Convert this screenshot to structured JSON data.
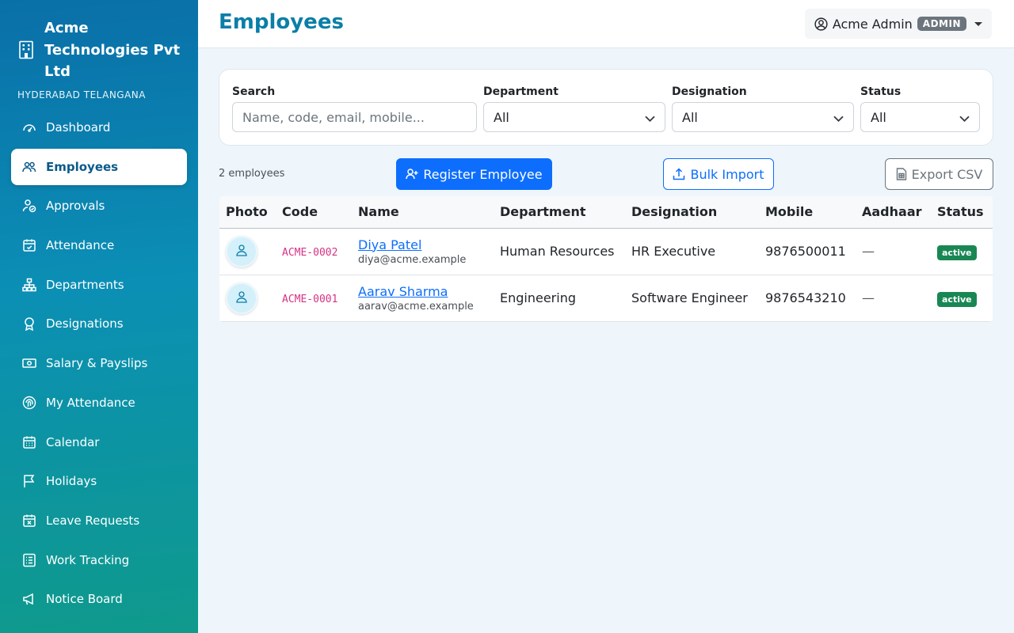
{
  "brand": {
    "name": "Acme Technologies Pvt Ltd",
    "location": "HYDERABAD TELANGANA"
  },
  "sidebar": {
    "items": [
      {
        "label": "Dashboard",
        "icon": "speedometer-icon"
      },
      {
        "label": "Employees",
        "icon": "people-icon",
        "active": true
      },
      {
        "label": "Approvals",
        "icon": "person-check-icon"
      },
      {
        "label": "Attendance",
        "icon": "calendar-check-icon"
      },
      {
        "label": "Departments",
        "icon": "diagram-icon"
      },
      {
        "label": "Designations",
        "icon": "award-icon"
      },
      {
        "label": "Salary & Payslips",
        "icon": "cash-icon"
      },
      {
        "label": "My Attendance",
        "icon": "fingerprint-icon"
      },
      {
        "label": "Calendar",
        "icon": "calendar-grid-icon"
      },
      {
        "label": "Holidays",
        "icon": "flag-icon"
      },
      {
        "label": "Leave Requests",
        "icon": "calendar-x-icon"
      },
      {
        "label": "Work Tracking",
        "icon": "list-check-icon"
      },
      {
        "label": "Notice Board",
        "icon": "megaphone-icon"
      }
    ]
  },
  "header": {
    "title": "Employees",
    "user_name": "Acme Admin",
    "role_badge": "ADMIN"
  },
  "filters": {
    "search_label": "Search",
    "search_placeholder": "Name, code, email, mobile...",
    "search_value": "",
    "department_label": "Department",
    "department_value": "All",
    "designation_label": "Designation",
    "designation_value": "All",
    "status_label": "Status",
    "status_value": "All"
  },
  "toolbar": {
    "count_text": "2 employees",
    "register_label": "Register Employee",
    "import_label": "Bulk Import",
    "export_label": "Export CSV"
  },
  "table": {
    "headers": [
      "Photo",
      "Code",
      "Name",
      "Department",
      "Designation",
      "Mobile",
      "Aadhaar",
      "Status"
    ],
    "rows": [
      {
        "code": "ACME-0002",
        "name": "Diya Patel",
        "email": "diya@acme.example",
        "department": "Human Resources",
        "designation": "HR Executive",
        "mobile": "9876500011",
        "aadhaar": "—",
        "status": "active"
      },
      {
        "code": "ACME-0001",
        "name": "Aarav Sharma",
        "email": "aarav@acme.example",
        "department": "Engineering",
        "designation": "Software Engineer",
        "mobile": "9876543210",
        "aadhaar": "—",
        "status": "active"
      }
    ]
  },
  "colors": {
    "accent": "#0b7ea8",
    "primary": "#0d6efd",
    "success": "#198754"
  }
}
